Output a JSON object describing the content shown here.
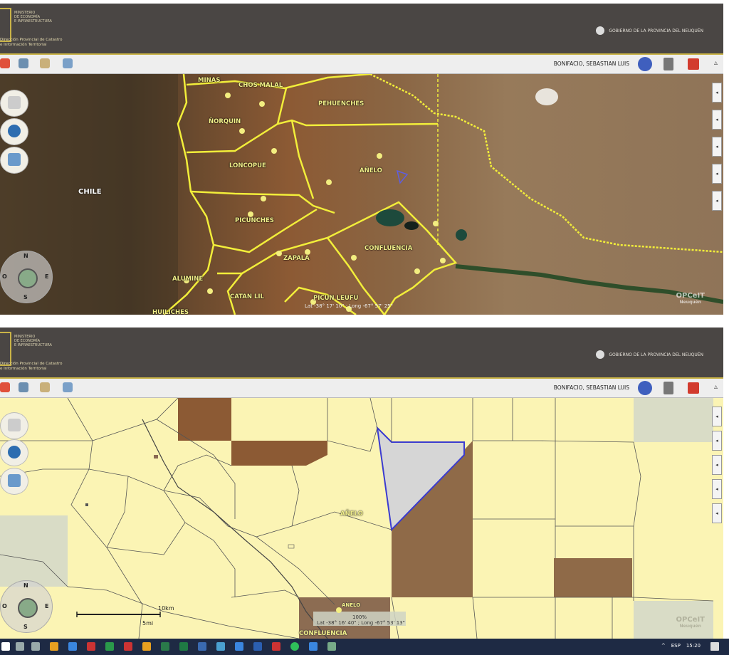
{
  "header": {
    "ministry": "MINISTERIO\nDE ECONOMÍA\nE INFRAESTRUCTURA",
    "direction": "Dirección Provincial de Catastro\ne Información Territorial",
    "government": "GOBIERNO DE LA PROVINCIA DEL NEUQUÉN"
  },
  "toolbar": {
    "user": "BONIFACIO, SEBASTIAN LUIS",
    "collapse": "▵"
  },
  "map1": {
    "labels": {
      "minas": "MINAS",
      "chos_malal": "CHOS MALAL",
      "pehuenches": "PEHUENCHES",
      "norquin": "ÑORQUIN",
      "loncopue": "LONCOPUE",
      "anelo": "AÑELO",
      "chile": "CHILE",
      "picunches": "PICUNCHES",
      "confluencia": "CONFLUENCIA",
      "zapala": "ZAPALA",
      "alumine": "ALUMINE",
      "catan_lil": "CATAN LIL",
      "picun_leufu": "PICUN LEUFU",
      "huiliches": "HUILICHES"
    },
    "coords": "Lat -38° 17' 10\" ; Long -67° 57' 25\""
  },
  "map2": {
    "labels": {
      "anelo": "AÑELO",
      "anelo_town": "AÑELO",
      "confluencia": "CONFLUENCIA"
    },
    "coords": "Lat -38° 16' 40\" ; Long -67° 53' 13\"",
    "zoom": "100%",
    "scale_km": "10km",
    "scale_mi": "5mi"
  },
  "compass": {
    "n": "N",
    "s": "S",
    "e": "E",
    "o": "O"
  },
  "watermark": {
    "main": "OPCeIT",
    "sub": "Neuquén"
  },
  "right_tab_glyph": "◂",
  "taskbar": {
    "tray": [
      "^",
      "ESP",
      "15:20"
    ]
  },
  "colors": {
    "header": "#4a4644",
    "accent": "#c9b347",
    "boundary": "#f2ee3a",
    "parcel": "#fbf4b4",
    "selected": "#d6d6d6",
    "taskbar": "#1e2a44"
  }
}
